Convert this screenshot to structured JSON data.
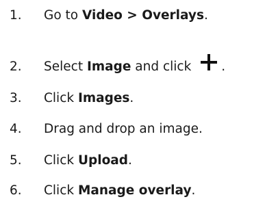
{
  "steps": [
    {
      "number": "1.",
      "before": "Go to ",
      "bold": "Video > Overlays",
      "after": "."
    },
    {
      "number": "2.",
      "before": "Select ",
      "bold": "Image",
      "after": " and click",
      "end": ".",
      "icon": "plus-icon"
    },
    {
      "number": "3.",
      "before": "Click ",
      "bold": "Images",
      "after": "."
    },
    {
      "number": "4.",
      "text": "Drag and drop an image."
    },
    {
      "number": "5.",
      "before": "Click ",
      "bold": "Upload",
      "after": "."
    },
    {
      "number": "6.",
      "before": "Click ",
      "bold": "Manage overlay",
      "after": "."
    }
  ]
}
